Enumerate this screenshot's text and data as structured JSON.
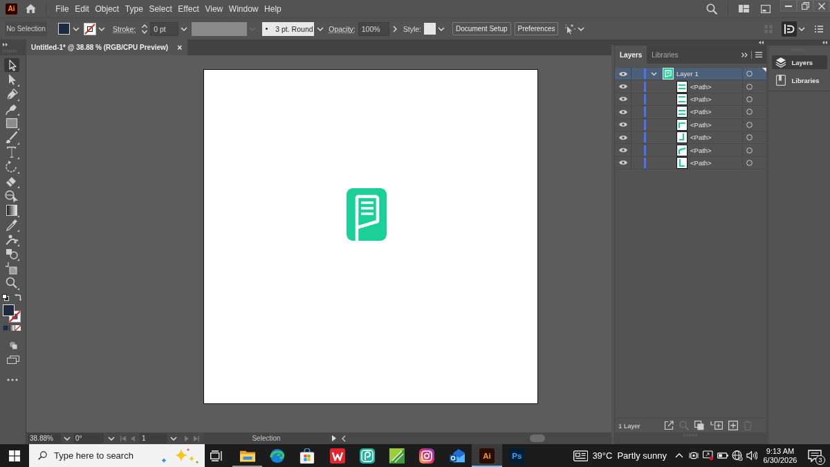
{
  "menu_bar": {
    "logo": "Ai",
    "items": [
      "File",
      "Edit",
      "Object",
      "Type",
      "Select",
      "Effect",
      "View",
      "Window",
      "Help"
    ]
  },
  "control_bar": {
    "selection": "No Selection",
    "stroke_label": "Stroke:",
    "stroke_weight": "0 pt",
    "brush": "3 pt. Round",
    "opacity_label": "Opacity:",
    "opacity": "100%",
    "style_label": "Style:",
    "buttons": [
      "Document Setup",
      "Preferences"
    ]
  },
  "document_tab": {
    "title": "Untitled-1* @ 38.88 % (RGB/CPU Preview)",
    "close": "×"
  },
  "toolbar": {
    "tools": [
      {
        "kind": "selection",
        "selected": true
      },
      {
        "kind": "direct-selection",
        "selected": false
      },
      {
        "kind": "pen",
        "selected": false
      },
      {
        "kind": "curvature",
        "selected": false
      },
      {
        "kind": "rectangle",
        "selected": false
      },
      {
        "kind": "paintbrush",
        "selected": false
      },
      {
        "kind": "type",
        "selected": false
      },
      {
        "kind": "rotate",
        "selected": false
      },
      {
        "kind": "eraser",
        "selected": false
      },
      {
        "kind": "shape-builder",
        "selected": false
      },
      {
        "kind": "gradient",
        "selected": false
      },
      {
        "kind": "eyedropper",
        "selected": false
      },
      {
        "kind": "puppet-warp",
        "selected": false
      },
      {
        "kind": "blend",
        "selected": false
      },
      {
        "kind": "artboard",
        "selected": false
      },
      {
        "kind": "zoom",
        "selected": false
      }
    ]
  },
  "layers_panel": {
    "tabs": [
      {
        "label": "Layers",
        "selected": true
      },
      {
        "label": "Libraries",
        "selected": false
      }
    ],
    "layers": [
      {
        "name": "Layer 1",
        "visible": true,
        "expanded": true,
        "selected": true,
        "children": [
          {
            "name": "<Path>",
            "visible": true,
            "selected": false
          },
          {
            "name": "<Path>",
            "visible": true,
            "selected": false
          },
          {
            "name": "<Path>",
            "visible": true,
            "selected": false
          },
          {
            "name": "<Path>",
            "visible": true,
            "selected": false
          },
          {
            "name": "<Path>",
            "visible": true,
            "selected": false
          },
          {
            "name": "<Path>",
            "visible": true,
            "selected": false
          },
          {
            "name": "<Path>",
            "visible": true,
            "selected": false
          }
        ]
      }
    ],
    "footer": "1 Layer"
  },
  "dock": [
    {
      "kind": "layers",
      "label": "Layers",
      "selected": true
    },
    {
      "kind": "libraries",
      "label": "Libraries",
      "selected": false
    }
  ],
  "status_bar": {
    "zoom": "38.88%",
    "rotation": "0°",
    "artboard": "1",
    "tool": "Selection"
  },
  "taskbar": {
    "search": {
      "placeholder": "Type here to search"
    },
    "apps": [
      {
        "kind": "folder",
        "running": true,
        "selected": false
      },
      {
        "kind": "browser",
        "running": false,
        "selected": false
      },
      {
        "kind": "store",
        "running": false,
        "selected": false
      },
      {
        "kind": "w-logo",
        "running": false,
        "selected": false
      },
      {
        "kind": "p-logo",
        "running": false,
        "selected": false
      },
      {
        "kind": "leaf-logo",
        "running": false,
        "selected": false
      },
      {
        "kind": "camera-logo",
        "running": false,
        "selected": false
      },
      {
        "kind": "mail-logo",
        "running": false,
        "selected": false
      },
      {
        "kind": "letters-orange",
        "label": "Ai",
        "running": true,
        "selected": true
      },
      {
        "kind": "letters-blue",
        "label": "Ps",
        "running": false,
        "selected": false
      }
    ],
    "weather": {
      "temperature": "39°C",
      "condition": "Partly sunny"
    },
    "time": "9:13 AM",
    "date": "6/30/2026",
    "notifications": "3"
  }
}
